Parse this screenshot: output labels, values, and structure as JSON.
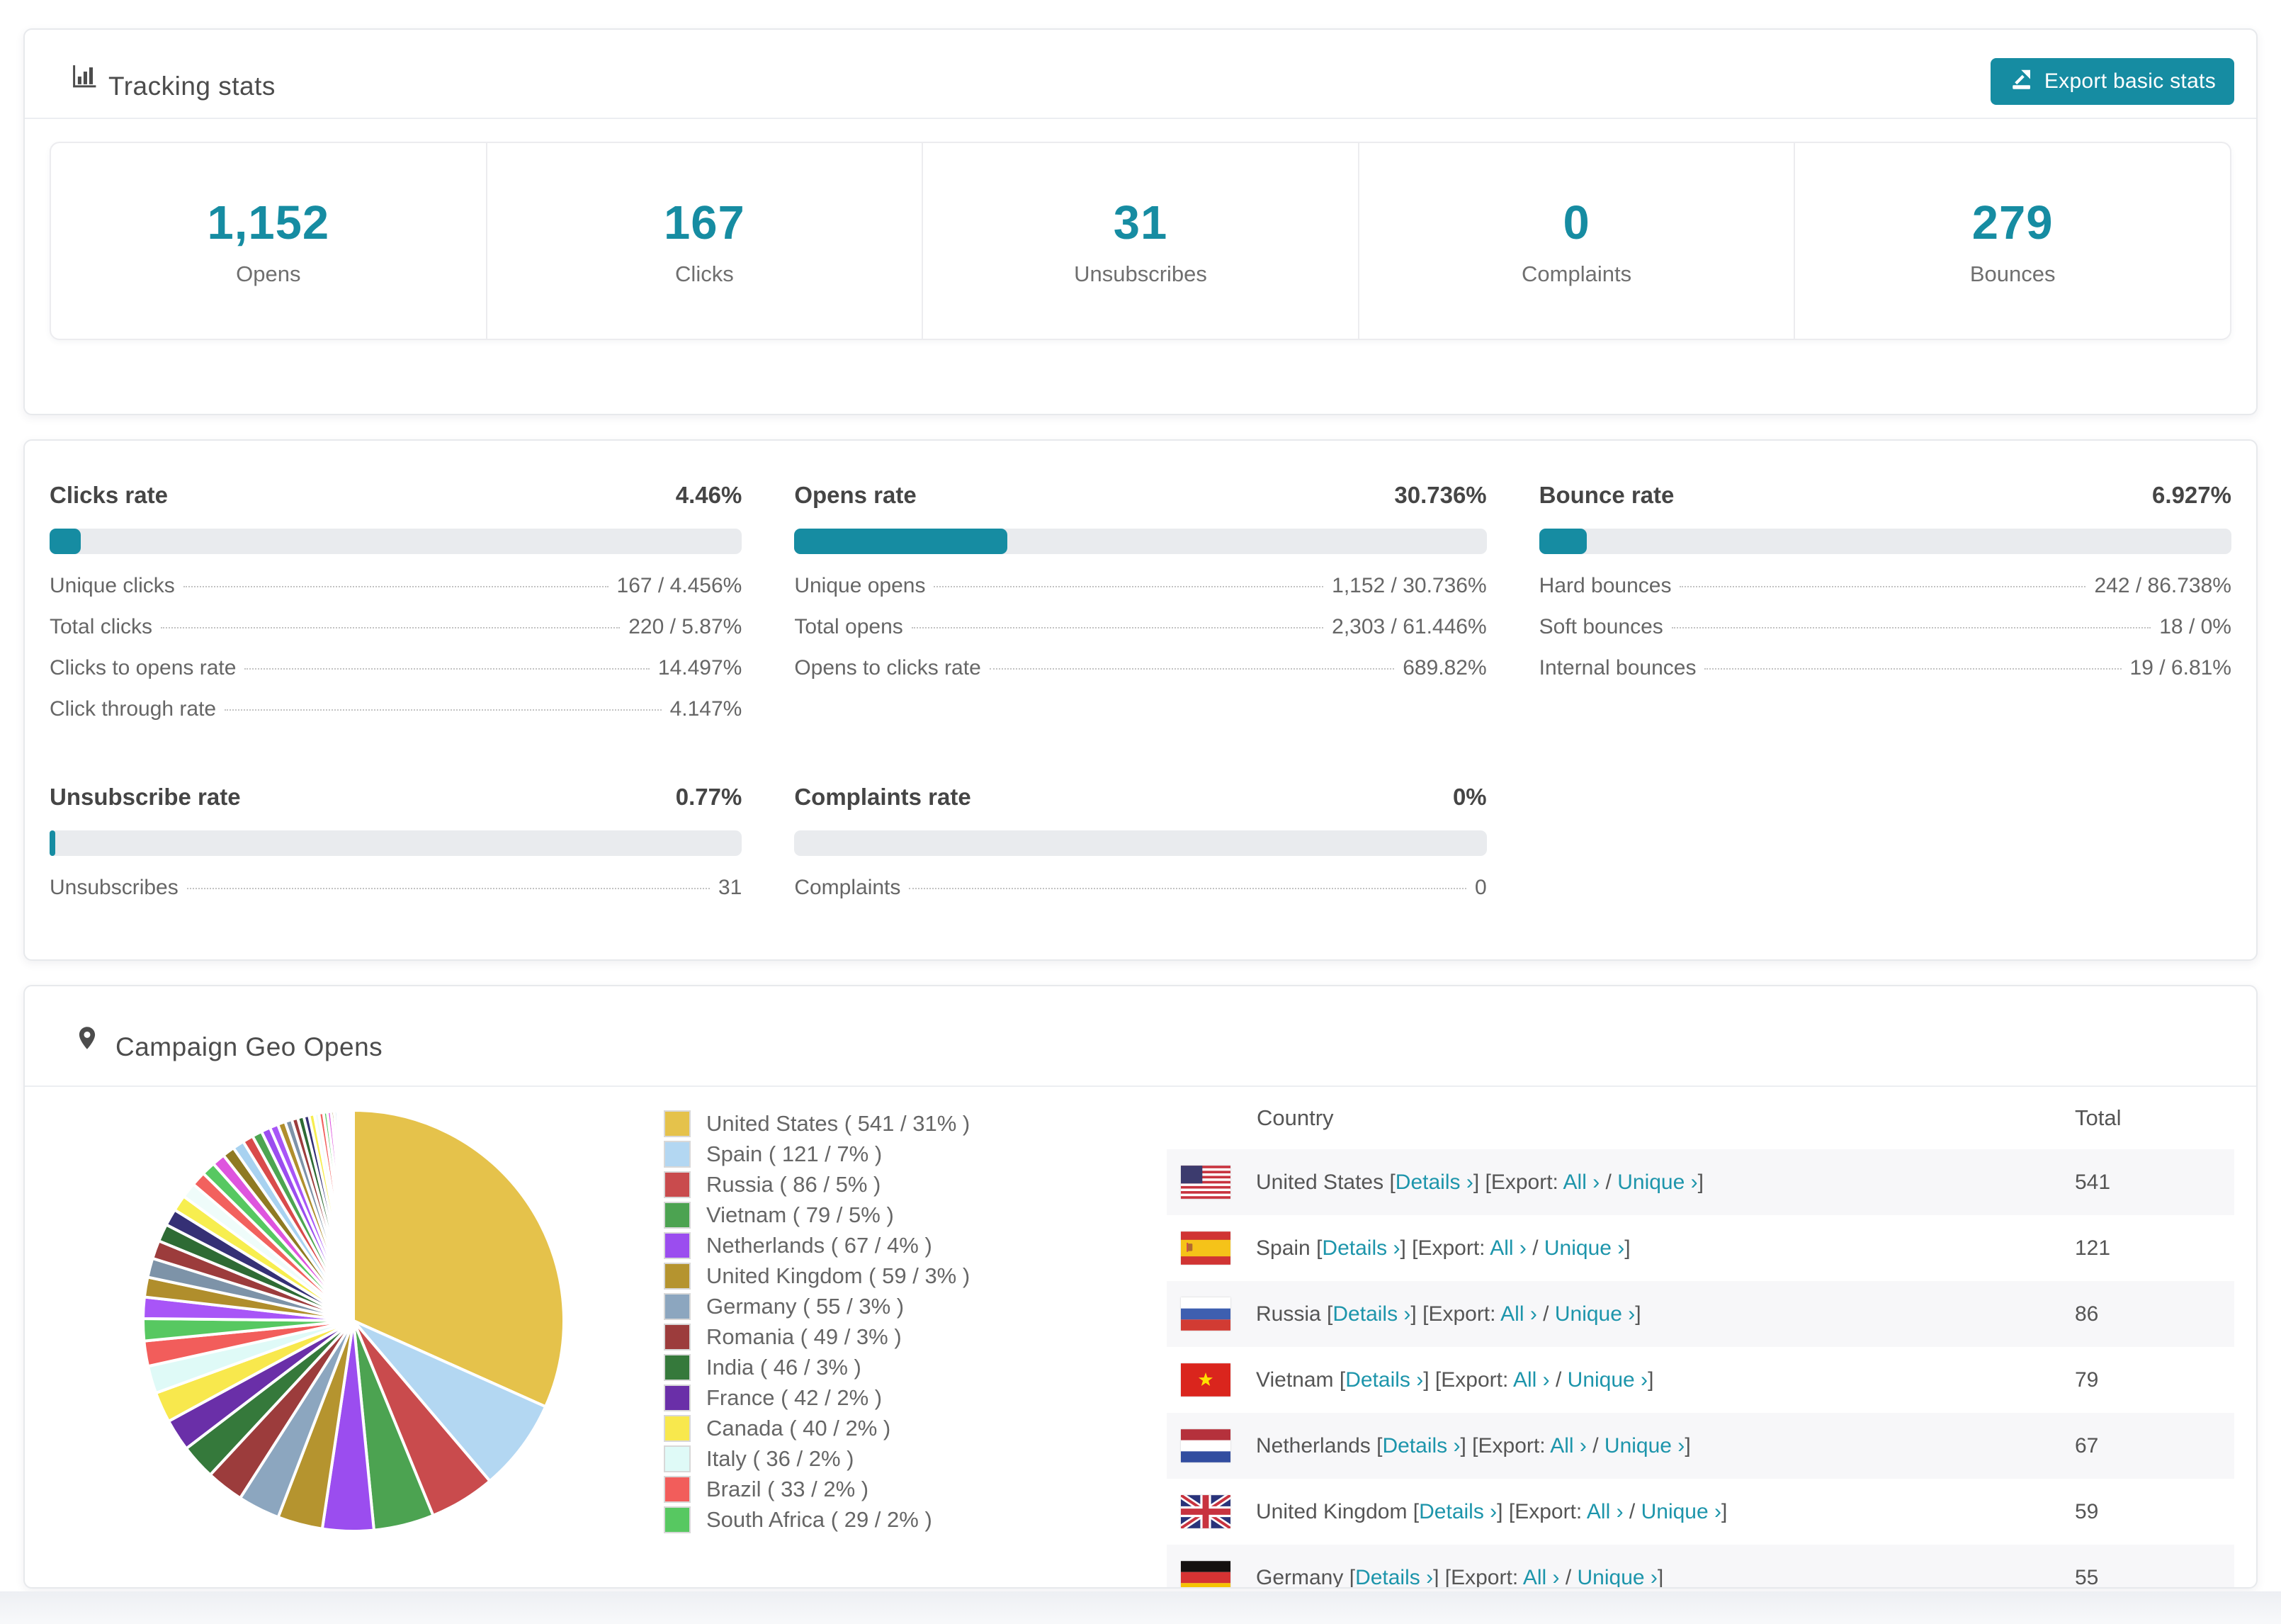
{
  "accent": "#168CA2",
  "link_color": "#1D95AB",
  "header": {
    "title": "Tracking stats",
    "icon": "bar-chart-icon",
    "export_button_label": "Export basic stats"
  },
  "summary_stats": [
    {
      "value": "1,152",
      "label": "Opens"
    },
    {
      "value": "167",
      "label": "Clicks"
    },
    {
      "value": "31",
      "label": "Unsubscribes"
    },
    {
      "value": "0",
      "label": "Complaints"
    },
    {
      "value": "279",
      "label": "Bounces"
    }
  ],
  "rate_panels": [
    {
      "id": "clicks-rate",
      "title": "Clicks rate",
      "value": "4.46%",
      "percent": 4.46,
      "rows": [
        {
          "label": "Unique clicks",
          "value": "167 / 4.456%"
        },
        {
          "label": "Total clicks",
          "value": "220 / 5.87%"
        },
        {
          "label": "Clicks to opens rate",
          "value": "14.497%"
        },
        {
          "label": "Click through rate",
          "value": "4.147%"
        }
      ]
    },
    {
      "id": "opens-rate",
      "title": "Opens rate",
      "value": "30.736%",
      "percent": 30.736,
      "rows": [
        {
          "label": "Unique opens",
          "value": "1,152 / 30.736%"
        },
        {
          "label": "Total opens",
          "value": "2,303 / 61.446%"
        },
        {
          "label": "Opens to clicks rate",
          "value": "689.82%"
        }
      ]
    },
    {
      "id": "bounce-rate",
      "title": "Bounce rate",
      "value": "6.927%",
      "percent": 6.927,
      "rows": [
        {
          "label": "Hard bounces",
          "value": "242 / 86.738%"
        },
        {
          "label": "Soft bounces",
          "value": "18 / 0%"
        },
        {
          "label": "Internal bounces",
          "value": "19 / 6.81%"
        }
      ]
    },
    {
      "id": "unsubscribe-rate",
      "title": "Unsubscribe rate",
      "value": "0.77%",
      "percent": 0.77,
      "rows": [
        {
          "label": "Unsubscribes",
          "value": "31"
        }
      ]
    },
    {
      "id": "complaints-rate",
      "title": "Complaints rate",
      "value": "0%",
      "percent": 0,
      "rows": [
        {
          "label": "Complaints",
          "value": "0"
        }
      ]
    }
  ],
  "geo": {
    "title": "Campaign Geo Opens",
    "icon": "map-pin-icon",
    "table_headers": {
      "country": "Country",
      "total": "Total"
    },
    "row_link_labels": {
      "details": "Details",
      "export_prefix": "Export:",
      "all": "All",
      "unique": "Unique",
      "chevron": "›"
    },
    "rows": [
      {
        "country": "United States",
        "flag": "us",
        "total": "541"
      },
      {
        "country": "Spain",
        "flag": "es",
        "total": "121"
      },
      {
        "country": "Russia",
        "flag": "ru",
        "total": "86"
      },
      {
        "country": "Vietnam",
        "flag": "vn",
        "total": "79"
      },
      {
        "country": "Netherlands",
        "flag": "nl",
        "total": "67"
      },
      {
        "country": "United Kingdom",
        "flag": "gb",
        "total": "59"
      },
      {
        "country": "Germany",
        "flag": "de",
        "total": "55"
      }
    ]
  },
  "chart_data": {
    "type": "pie",
    "title": "Campaign Geo Opens",
    "legend_position": "right",
    "start_angle_deg": 0,
    "direction": "clockwise",
    "series": [
      {
        "name": "United States",
        "value": 541,
        "pct": "31%",
        "color": "#E5C24B"
      },
      {
        "name": "Spain",
        "value": 121,
        "pct": "7%",
        "color": "#B3D7F2"
      },
      {
        "name": "Russia",
        "value": 86,
        "pct": "5%",
        "color": "#C94B4D"
      },
      {
        "name": "Vietnam",
        "value": 79,
        "pct": "5%",
        "color": "#4CA351"
      },
      {
        "name": "Netherlands",
        "value": 67,
        "pct": "4%",
        "color": "#9B4DEF"
      },
      {
        "name": "United Kingdom",
        "value": 59,
        "pct": "3%",
        "color": "#B5942F"
      },
      {
        "name": "Germany",
        "value": 55,
        "pct": "3%",
        "color": "#8CA6BF"
      },
      {
        "name": "Romania",
        "value": 49,
        "pct": "3%",
        "color": "#9C3C3C"
      },
      {
        "name": "India",
        "value": 46,
        "pct": "3%",
        "color": "#35793B"
      },
      {
        "name": "France",
        "value": 42,
        "pct": "2%",
        "color": "#6A2FA8"
      },
      {
        "name": "Canada",
        "value": 40,
        "pct": "2%",
        "color": "#F8E84D"
      },
      {
        "name": "Italy",
        "value": 36,
        "pct": "2%",
        "color": "#DFFAF7"
      },
      {
        "name": "Brazil",
        "value": 33,
        "pct": "2%",
        "color": "#F25D5B"
      },
      {
        "name": "South Africa",
        "value": 29,
        "pct": "2%",
        "color": "#57C861"
      }
    ],
    "unlabeled_tail_values": [
      28,
      26,
      25,
      24,
      23,
      22,
      21,
      20,
      19,
      18,
      17,
      16,
      15,
      14,
      13,
      12,
      11,
      10,
      9,
      8,
      8,
      7,
      7,
      6,
      6,
      5,
      5,
      4,
      4,
      3,
      3,
      3,
      2,
      2,
      2,
      2,
      1,
      1,
      1,
      1
    ],
    "unlabeled_tail_palette": [
      "#A855F7",
      "#B08E2C",
      "#7D93A8",
      "#9C3C3C",
      "#2E6B34",
      "#353075",
      "#F7EE4F",
      "#EFFCFA",
      "#F2615E",
      "#57C861",
      "#DE55DE",
      "#8F7A22",
      "#A8D2F0",
      "#D94B4B",
      "#4DA551",
      "#9B4DEF"
    ]
  }
}
